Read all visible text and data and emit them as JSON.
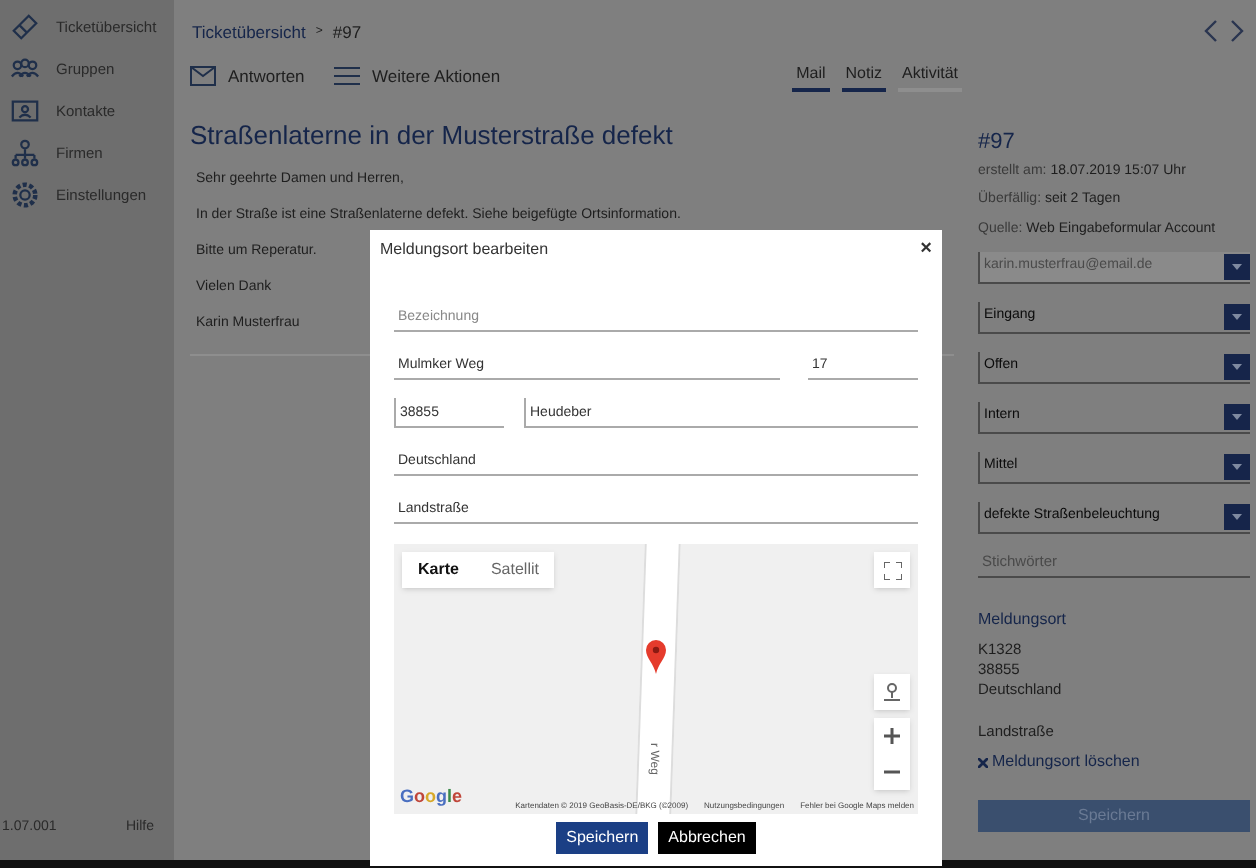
{
  "sidebar": {
    "items": [
      {
        "label": "Ticketübersicht"
      },
      {
        "label": "Gruppen"
      },
      {
        "label": "Kontakte"
      },
      {
        "label": "Firmen"
      },
      {
        "label": "Einstellungen"
      }
    ],
    "version": "1.07.001",
    "help": "Hilfe"
  },
  "breadcrumb": {
    "parent": "Ticketübersicht",
    "separator": ">",
    "current": "#97"
  },
  "actions": [
    {
      "label": "Antworten"
    },
    {
      "label": "Weitere Aktionen"
    }
  ],
  "tabs": [
    {
      "label": "Mail",
      "selected": true
    },
    {
      "label": "Notiz",
      "selected": true
    },
    {
      "label": "Aktivität",
      "selected": false
    }
  ],
  "ticket": {
    "title": "Straßenlaterne in der Musterstraße defekt",
    "body": [
      "Sehr geehrte Damen und Herren,",
      "In der Straße ist eine Straßenlaterne defekt. Siehe beigefügte Ortsinformation.",
      "Bitte um Reperatur.",
      "Vielen Dank",
      "Karin Musterfrau"
    ]
  },
  "details": {
    "number": "#97",
    "meta": [
      {
        "label": "erstellt am:",
        "value": "18.07.2019 15:07 Uhr"
      },
      {
        "label": "Überfällig:",
        "value": "seit 2 Tagen"
      },
      {
        "label": "Quelle:",
        "value": "Web Eingabeformular Account"
      }
    ],
    "selects": [
      {
        "value": "karin.musterfrau@email.de",
        "disabled": true
      },
      {
        "value": "Eingang",
        "disabled": false
      },
      {
        "value": "Offen",
        "disabled": false
      },
      {
        "value": "Intern",
        "disabled": false
      },
      {
        "value": "Mittel",
        "disabled": false
      },
      {
        "value": "defekte Straßenbeleuchtung",
        "disabled": false
      }
    ],
    "keywords": {
      "placeholder": "Stichwörter"
    },
    "location": {
      "heading": "Meldungsort",
      "lines": [
        "K1328",
        "38855",
        "Deutschland"
      ],
      "type": "Landstraße",
      "delete_link": "Meldungsort löschen"
    },
    "save_button": "Speichern"
  },
  "modal": {
    "title": "Meldungsort bearbeiten",
    "close": "×",
    "rows": [
      [
        {
          "placeholder": "Bezeichnung"
        }
      ],
      [
        {
          "value": "Mulmker Weg"
        },
        {
          "value": "17"
        }
      ],
      [
        {
          "value": "38855"
        },
        {
          "value": "Heudeber"
        }
      ],
      [
        {
          "value": "Deutschland"
        }
      ],
      [
        {
          "value": "Landstraße"
        }
      ]
    ],
    "map": {
      "tabs": [
        {
          "label": "Karte",
          "selected": true
        },
        {
          "label": "Satellit",
          "selected": false
        }
      ],
      "road_label": "r Weg",
      "logo": "Google",
      "attribution": [
        "Kartendaten © 2019 GeoBasis-DE/BKG (©2009)",
        "Nutzungsbedingungen",
        "Fehler bei Google Maps melden"
      ]
    },
    "buttons": [
      {
        "label": "Speichern",
        "kind": "primary"
      },
      {
        "label": "Abbrechen",
        "kind": "secondary"
      }
    ]
  }
}
